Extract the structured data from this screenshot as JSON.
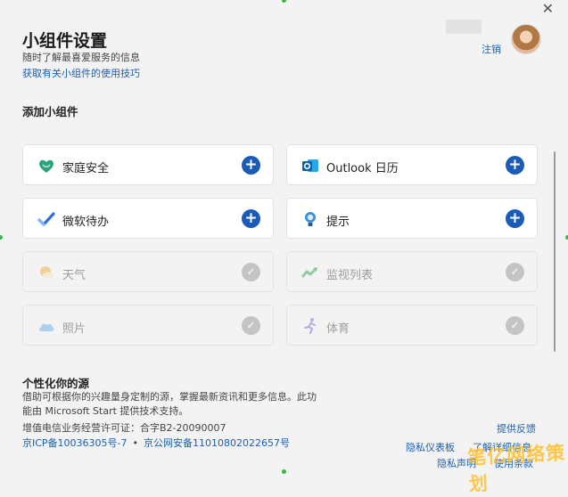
{
  "header": {
    "title": "小组件设置",
    "subtitle": "随时了解最喜爱服务的信息",
    "tips_link": "获取有关小组件的使用技巧",
    "signout": "注销"
  },
  "widgets_section": {
    "label": "添加小组件",
    "items": [
      {
        "label": "家庭安全",
        "icon": "heart-shield-icon",
        "state": "add"
      },
      {
        "label": "Outlook 日历",
        "icon": "outlook-calendar-icon",
        "state": "add"
      },
      {
        "label": "微软待办",
        "icon": "todo-check-icon",
        "state": "add"
      },
      {
        "label": "提示",
        "icon": "tips-lightbulb-icon",
        "state": "add"
      },
      {
        "label": "天气",
        "icon": "weather-icon",
        "state": "added"
      },
      {
        "label": "监视列表",
        "icon": "stock-watchlist-icon",
        "state": "added"
      },
      {
        "label": "照片",
        "icon": "cloud-photos-icon",
        "state": "added"
      },
      {
        "label": "体育",
        "icon": "sports-runner-icon",
        "state": "added"
      }
    ]
  },
  "personalize": {
    "title": "个性化你的源",
    "description": "借助可根据你的兴趣量身定制的源，掌握最新资讯和更多信息。此功能由 Microsoft Start 提供技术支持。",
    "license": "增值电信业务经营许可证：合字B2-20090007",
    "icp1": "京ICP备10036305号-7",
    "separator": "•",
    "icp2": "京公网安备11010802022657号"
  },
  "footer_links": {
    "feedback": "提供反馈",
    "privacy_dashboard": "隐私仪表板",
    "ad_choices": "了解详细信息",
    "privacy_statement": "隐私声明",
    "terms": "使用条款"
  },
  "watermark": "笔亿网络策划",
  "colors": {
    "accent": "#1b5bb8",
    "link": "#1a5fb4",
    "disabled_check": "#c4c4c4",
    "background": "#f3f3f3"
  }
}
